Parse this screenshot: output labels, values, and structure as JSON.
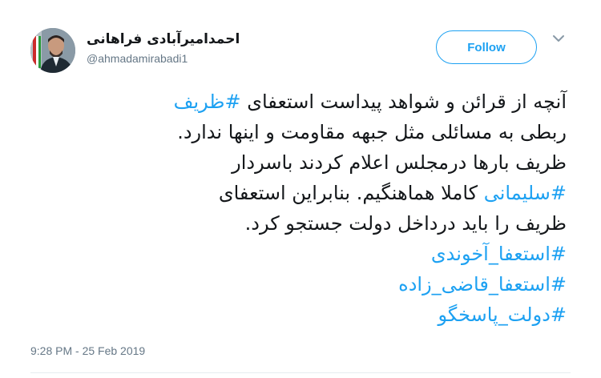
{
  "author": {
    "display_name": "احمدامیرآبادی فراهانی",
    "handle": "@ahmadamirabadi1"
  },
  "follow_button": {
    "label": "Follow"
  },
  "tweet": {
    "lines": [
      [
        {
          "text": "آنچه از قرائن و شواهد پیداست استعفای ",
          "hashtag": false
        },
        {
          "text": "#ظریف",
          "hashtag": true
        }
      ],
      [
        {
          "text": "ربطی به مسائلی مثل جبهه مقاومت و اینها ندارد.",
          "hashtag": false
        }
      ],
      [
        {
          "text": "ظریف بارها درمجلس اعلام کردند باسردار",
          "hashtag": false
        }
      ],
      [
        {
          "text": "#سلیمانی",
          "hashtag": true
        },
        {
          "text": " کاملا هماهنگیم. بنابراین استعفای",
          "hashtag": false
        }
      ],
      [
        {
          "text": "ظریف را باید درداخل دولت جستجو کرد.",
          "hashtag": false
        }
      ],
      [
        {
          "text": "#استعفا_آخوندی",
          "hashtag": true
        }
      ],
      [
        {
          "text": "#استعفا_قاضی_زاده",
          "hashtag": true
        }
      ],
      [
        {
          "text": "#دولت_پاسخگو",
          "hashtag": true
        }
      ]
    ],
    "timestamp": "9:28 PM - 25 Feb 2019"
  },
  "colors": {
    "link": "#1da1f2",
    "text": "#14171a",
    "secondary": "#657786"
  },
  "icons": {
    "menu": "chevron-down-icon"
  }
}
